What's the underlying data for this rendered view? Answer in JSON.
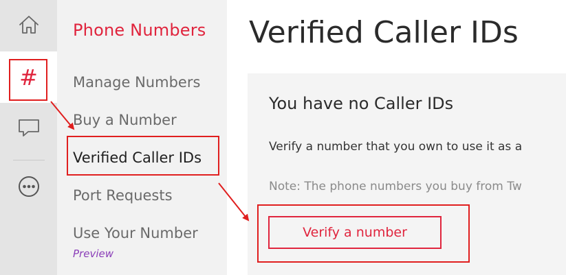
{
  "rail": {
    "items": [
      {
        "icon": "home-icon"
      },
      {
        "icon": "hash-icon",
        "glyph": "#"
      },
      {
        "icon": "chat-icon"
      },
      {
        "icon": "more-icon"
      }
    ]
  },
  "subnav": {
    "title": "Phone Numbers",
    "links": [
      {
        "label": "Manage Numbers"
      },
      {
        "label": "Buy a Number"
      },
      {
        "label": "Verified Caller IDs"
      },
      {
        "label": "Port Requests"
      },
      {
        "label": "Use Your Number"
      }
    ],
    "preview_tag": "Preview"
  },
  "main": {
    "title": "Verified Caller IDs",
    "empty_card": {
      "heading": "You have no Caller IDs",
      "text": "Verify a number that you own to use it as a",
      "note": "Note: The phone numbers you buy from Tw",
      "button_label": "Verify a number"
    }
  },
  "colors": {
    "accent": "#e0243d",
    "annotation": "#e01e1e",
    "preview": "#8a3db8"
  }
}
